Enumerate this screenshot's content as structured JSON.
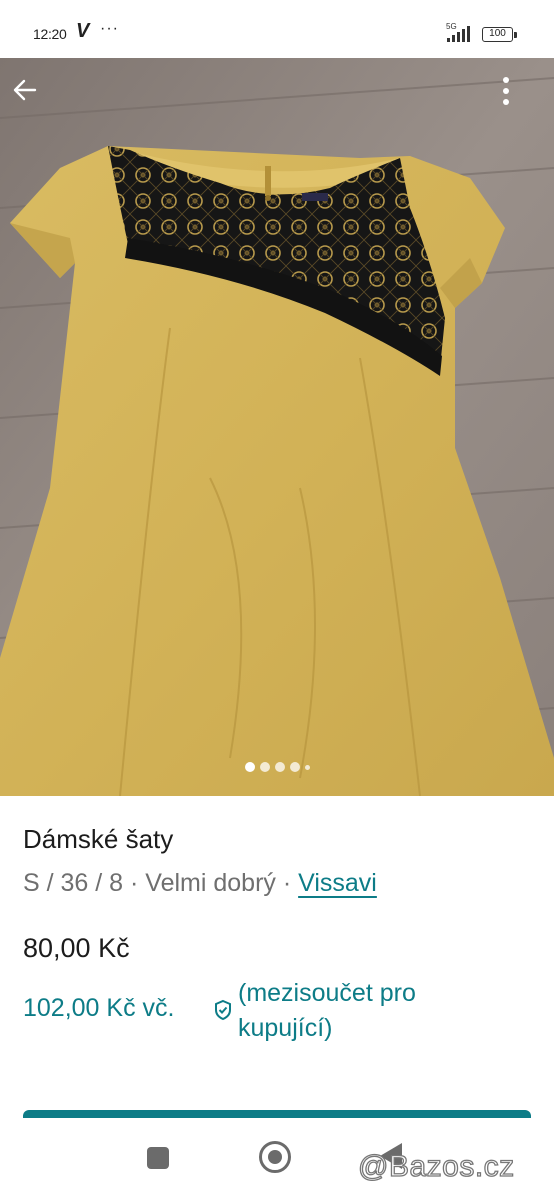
{
  "status_bar": {
    "time": "12:20",
    "carrier_icon": "V",
    "overflow": "···",
    "network": "5G",
    "battery": "100"
  },
  "photo": {
    "description_icon": "dress-photo",
    "page_count": 5,
    "active_page": 1
  },
  "listing": {
    "title": "Dámské šaty",
    "size": "S / 36 / 8",
    "separator": " · ",
    "condition": "Velmi dobrý",
    "brand": "Vissavi",
    "price": "80,00 Kč",
    "buyer_price": "102,00 Kč vč.",
    "buyer_note": "(mezisoučet pro kupující)"
  },
  "watermark": "@Bazos.cz",
  "colors": {
    "accent": "#0d7c87",
    "dress": "#d4b358",
    "lace": "#141414",
    "floor": "#8d837d"
  }
}
